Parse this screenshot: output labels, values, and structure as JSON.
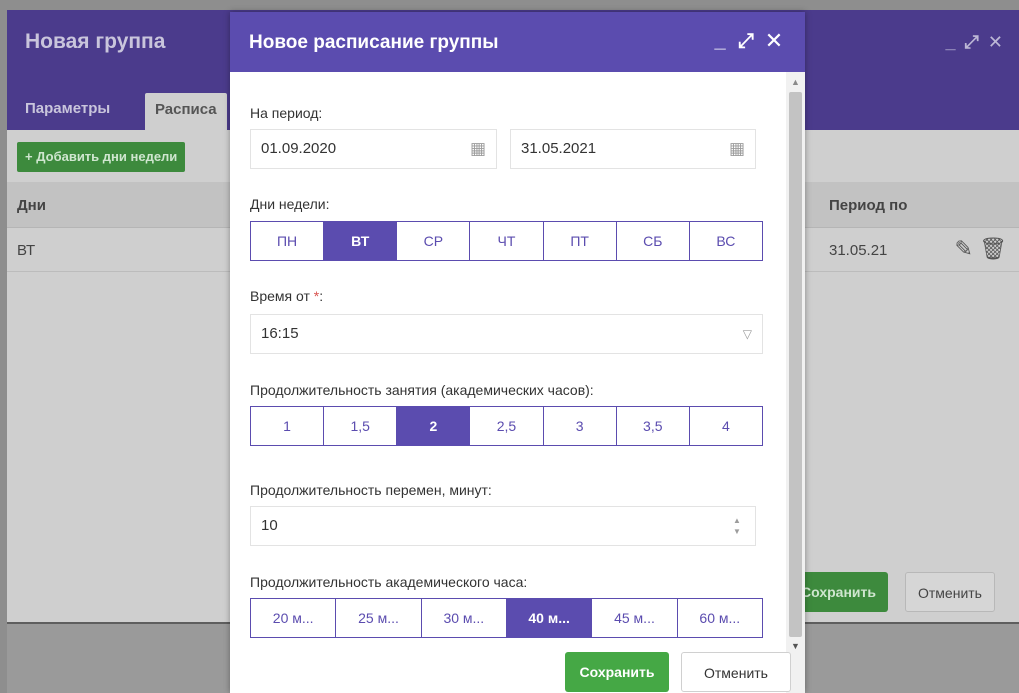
{
  "background": {
    "title": "Новая группа",
    "tabs": [
      {
        "label": "Параметры"
      },
      {
        "label": "Расписа"
      }
    ],
    "add_button": "+ Добавить дни недели",
    "table": {
      "headers": {
        "days": "Дни",
        "period_to": "Период по"
      },
      "row": {
        "days": "ВТ",
        "period_to": "31.05.21"
      }
    },
    "save_label": "Сохранить",
    "cancel_label": "Отменить"
  },
  "modal": {
    "title": "Новое расписание группы",
    "period": {
      "label": "На период:",
      "date_from": "01.09.2020",
      "date_to": "31.05.2021"
    },
    "weekdays": {
      "label": "Дни недели:",
      "options": [
        "ПН",
        "ВТ",
        "СР",
        "ЧТ",
        "ПТ",
        "СБ",
        "ВС"
      ],
      "selected": "ВТ"
    },
    "time_from": {
      "label": "Время от",
      "required_mark": "*",
      "suffix": ":",
      "value": "16:15"
    },
    "lesson_duration": {
      "label": "Продолжительность занятия (академических часов):",
      "options": [
        "1",
        "1,5",
        "2",
        "2,5",
        "3",
        "3,5",
        "4"
      ],
      "selected": "2"
    },
    "break_duration": {
      "label": "Продолжительность перемен, минут:",
      "value": "10"
    },
    "academic_hour": {
      "label": "Продолжительность академического часа:",
      "options": [
        "20 м...",
        "25 м...",
        "30 м...",
        "40 м...",
        "45 м...",
        "60 м..."
      ],
      "selected": "40 м..."
    },
    "save_label": "Сохранить",
    "cancel_label": "Отменить"
  },
  "colors": {
    "primary": "#5b4caf",
    "success": "#45a845",
    "required": "#d9534f"
  }
}
